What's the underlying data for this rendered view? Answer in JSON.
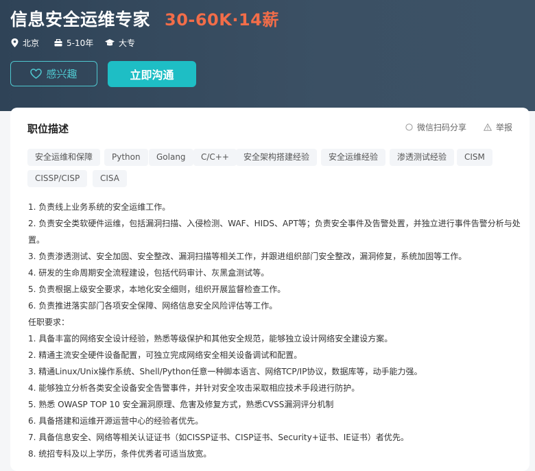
{
  "job": {
    "title": "信息安全运维专家",
    "salary": "30-60K·14薪",
    "location": "北京",
    "experience": "5-10年",
    "education": "大专"
  },
  "actions": {
    "interest_label": "感兴趣",
    "chat_label": "立即沟通"
  },
  "card": {
    "section_title": "职位描述",
    "share_label": "微信扫码分享",
    "report_label": "举报"
  },
  "tags": [
    "安全运维和保障",
    "Python",
    "Golang",
    "C/C++",
    "安全架构搭建经验",
    "安全运维经验",
    "渗透测试经验",
    "CISM",
    "CISSP/CISP",
    "CISA"
  ],
  "description": [
    "1. 负责线上业务系统的安全运维工作。",
    "2. 负责安全类软硬件运维，包括漏洞扫描、入侵检测、WAF、HIDS、APT等；负责安全事件及告警处置，并独立进行事件告警分析与处置。",
    "3. 负责渗透测试、安全加固、安全整改、漏洞扫描等相关工作，并跟进组织部门安全整改，漏洞修复，系统加固等工作。",
    "4. 研发的生命周期安全流程建设，包括代码审计、灰黑盒测试等。",
    "5. 负责根据上级安全要求，本地化安全细则，组织开展监督检查工作。",
    "6. 负责推进落实部门各项安全保障、网络信息安全风险评估等工作。",
    "任职要求：",
    "1. 具备丰富的网络安全设计经验，熟悉等级保护和其他安全规范，能够独立设计网络安全建设方案。",
    "2. 精通主流安全硬件设备配置，可独立完成网络安全相关设备调试和配置。",
    "3. 精通Linux/Unix操作系统、Shell/Python任意一种脚本语言、网络TCP/IP协议，数据库等，动手能力强。",
    "4. 能够独立分析各类安全设备安全告警事件，并针对安全攻击采取相应技术手段进行防护。",
    "5. 熟悉 OWASP TOP 10 安全漏洞原理、危害及修复方式，熟悉CVSS漏洞评分机制",
    "6. 具备搭建和运维开源运营中心的经验者优先。",
    "7. 具备信息安全、网络等相关认证证书（如CISSP证书、CISP证书、Security+证书、IE证书）者优先。",
    "8. 统招专科及以上学历，条件优秀者可适当放宽。"
  ],
  "colors": {
    "header_bg": "#34495d",
    "salary": "#f26d49",
    "accent": "#1ebec5"
  }
}
